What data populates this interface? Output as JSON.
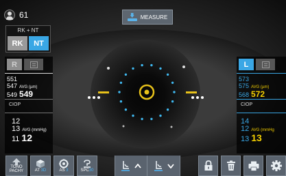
{
  "patient": {
    "id": "61"
  },
  "mode": {
    "title": "RK + NT",
    "rk_label": "RK",
    "nt_label": "NT"
  },
  "measure_button": {
    "label": "MEASURE"
  },
  "left_eye": {
    "tab_label": "R",
    "readings": [
      "551",
      "547",
      "549"
    ],
    "avg_label": "AVG (µm)",
    "avg_value": "549",
    "ciop_label": "CIOP",
    "iop_readings": [
      "12",
      "13",
      "11"
    ],
    "iop_avg_label": "AVG (mmHg)",
    "iop_avg_value": "12"
  },
  "right_eye": {
    "tab_label": "L",
    "readings": [
      "573",
      "575",
      "568"
    ],
    "avg_label": "AVG (µm)",
    "avg_value": "572",
    "ciop_label": "CIOP",
    "iop_readings": [
      "14",
      "12",
      "13"
    ],
    "iop_avg_label": "AVG (mmHg",
    "iop_avg_value": "13"
  },
  "toolbar": {
    "tono_pachy_label": "TONO\nPACHY",
    "at_prefix": "AT",
    "at_value": "3D",
    "as_prefix": "AS",
    "as_value": "3",
    "spc_prefix": "SPC",
    "spc_value": "30"
  },
  "colors": {
    "accent_blue": "#3aa7e5",
    "avg_yellow": "#f5d000",
    "target_yellow": "#e8c21a",
    "button_gray": "#5a636e"
  },
  "icons": [
    "user-icon",
    "measure-icon",
    "list-icon",
    "tono-pachy-icon",
    "cube-icon",
    "target-icon",
    "spc-icon",
    "chinrest-up-icon",
    "chinrest-down-icon",
    "lock-icon",
    "trash-icon",
    "print-icon",
    "gear-icon"
  ]
}
